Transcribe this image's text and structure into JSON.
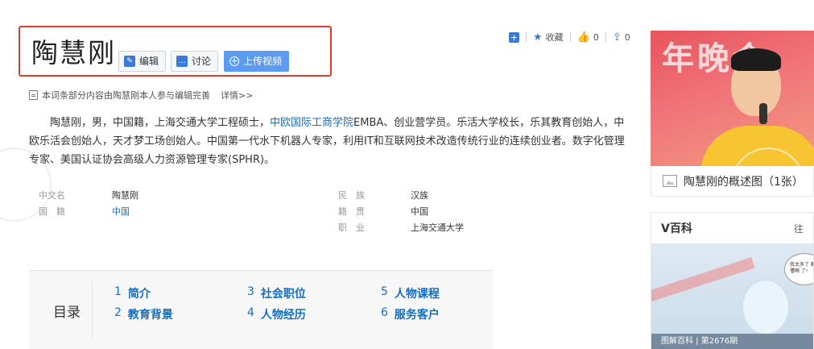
{
  "entry": {
    "title": "陶慧刚",
    "edit_label": "编辑",
    "discuss_label": "讨论",
    "upload_label": "上传视频"
  },
  "actions": {
    "favorite_label": "收藏",
    "like_count": "0",
    "share_count": "0"
  },
  "note": {
    "text": "本词条部分内容由陶慧刚本人参与编辑完善",
    "more_label": "详情>>"
  },
  "summary": {
    "part1": "陶慧刚，男，中国籍，上海交通大学工程硕士，",
    "link": "中欧国际工商学院",
    "part2": "EMBA、创业营学员。乐活大学校长，乐其教育创始人，中欧乐活会创始人，天才梦工场创始人。中国第一代水下机器人专家，利用IT和互联网技术改造传统行业的连续创业者。数字化管理专家、美国认证协会高级人力资源管理专家(SPHR)。"
  },
  "basic_info": {
    "left": [
      {
        "key": "中文名",
        "value": "陶慧刚"
      },
      {
        "key": "国　籍",
        "value": "中国"
      }
    ],
    "right": [
      {
        "key": "民　族",
        "value": "汉族"
      },
      {
        "key": "籍　贯",
        "value": "中国"
      },
      {
        "key": "职　业",
        "value": "上海交通大学"
      }
    ]
  },
  "catalog": {
    "label": "目录",
    "items": [
      {
        "num": "1",
        "label": "简介"
      },
      {
        "num": "2",
        "label": "教育背景"
      },
      {
        "num": "3",
        "label": "社会职位"
      },
      {
        "num": "4",
        "label": "人物经历"
      },
      {
        "num": "5",
        "label": "人物课程"
      },
      {
        "num": "6",
        "label": "服务客户"
      }
    ]
  },
  "sidebar": {
    "photo_banner_text": "年晚会",
    "photo_caption": "陶慧刚的概述图（1张）",
    "vbaike_title": "V百科",
    "vbaike_more": "往",
    "vbaike_bubble": "我太多了 都不懂啊 了!",
    "vbaike_footer": "图解百科 | 第2676期"
  },
  "colors": {
    "accent_red": "#e33b2f",
    "link_blue": "#136ec2",
    "upload_blue": "#5b9cf0"
  }
}
